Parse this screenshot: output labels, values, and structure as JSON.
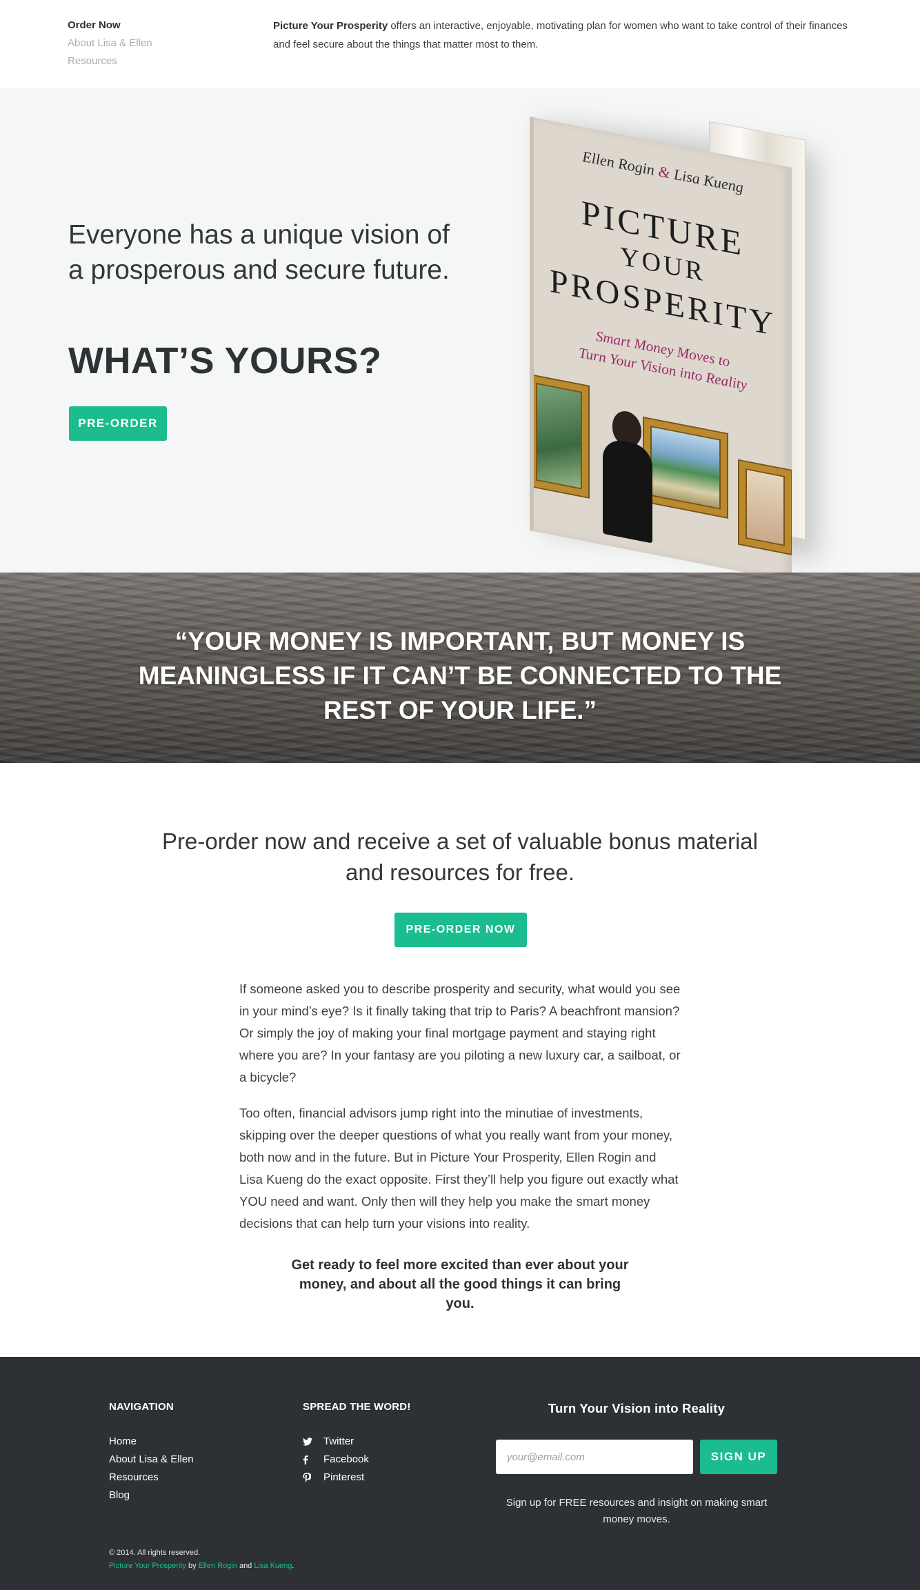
{
  "nav": {
    "items": [
      "Order Now",
      "About Lisa & Ellen",
      "Resources"
    ]
  },
  "intro": {
    "book_title": "Picture Your Prosperity",
    "text": " offers an interactive, enjoyable, motivating plan for women who want to take control of their finances and feel secure about the things that matter most to them."
  },
  "hero": {
    "tagline": "Everyone has a unique vision of a prosperous and secure future.",
    "headline": "WHAT’S YOURS?",
    "button": "PRE-ORDER"
  },
  "book_cover": {
    "authors_part1": "Ellen Rogin",
    "amp": "&",
    "authors_part2": "Lisa Kueng",
    "title_line1": "PICTURE",
    "title_line2": "YOUR",
    "title_line3": "PROSPERITY",
    "subtitle_line1": "Smart Money Moves to",
    "subtitle_line2": "Turn Your Vision into Reality"
  },
  "quote": {
    "text": "“YOUR MONEY IS IMPORTANT, BUT MONEY IS MEANINGLESS IF IT CAN’T BE CONNECTED TO THE REST OF YOUR LIFE.”"
  },
  "main": {
    "heading": "Pre-order now and receive a set of valuable bonus material and resources for free.",
    "button": "PRE-ORDER NOW",
    "paragraph1": "If someone asked you to describe prosperity and security, what would you see in your mind’s eye? Is it finally taking that trip to Paris? A beachfront mansion? Or simply the joy of making your final mortgage payment and staying right where you are? In your fantasy are you piloting a new luxury car, a sailboat, or a bicycle?",
    "paragraph2": "Too often, financial advisors jump right into the minutiae of investments, skipping over the deeper questions of what you really want from your money, both now and in the future. But in Picture Your Prosperity, Ellen Rogin and Lisa Kueng do the exact opposite. First they’ll help you figure out exactly what YOU need and want. Only then will they help you make the smart money decisions that can help turn your visions into reality.",
    "closing": "Get ready to feel more excited than ever about your money, and about all the good things it can bring you."
  },
  "footer": {
    "nav_heading": "NAVIGATION",
    "nav_items": [
      "Home",
      "About Lisa & Ellen",
      "Resources",
      "Blog"
    ],
    "spread_heading": "SPREAD THE WORD!",
    "social": [
      {
        "label": "Twitter",
        "icon": "twitter-icon"
      },
      {
        "label": "Facebook",
        "icon": "facebook-icon"
      },
      {
        "label": "Pinterest",
        "icon": "pinterest-icon"
      }
    ],
    "cta_heading": "Turn Your Vision into Reality",
    "email_placeholder": "your@email.com",
    "signup_button": "SIGN UP",
    "signup_note": "Sign up for FREE resources and insight on making smart money moves.",
    "copyright": "© 2014. All rights reserved.",
    "credit_site": "Picture Your Prosperity",
    "credit_by": " by ",
    "credit_author1": "Ellen Rogin",
    "credit_and": " and ",
    "credit_author2": "Lisa Kueng",
    "credit_end": "."
  },
  "colors": {
    "accent": "#1bbc8d",
    "dark": "#2d3135",
    "hero_bg": "#f5f6f6",
    "cover_subtitle": "#9a2c67"
  }
}
